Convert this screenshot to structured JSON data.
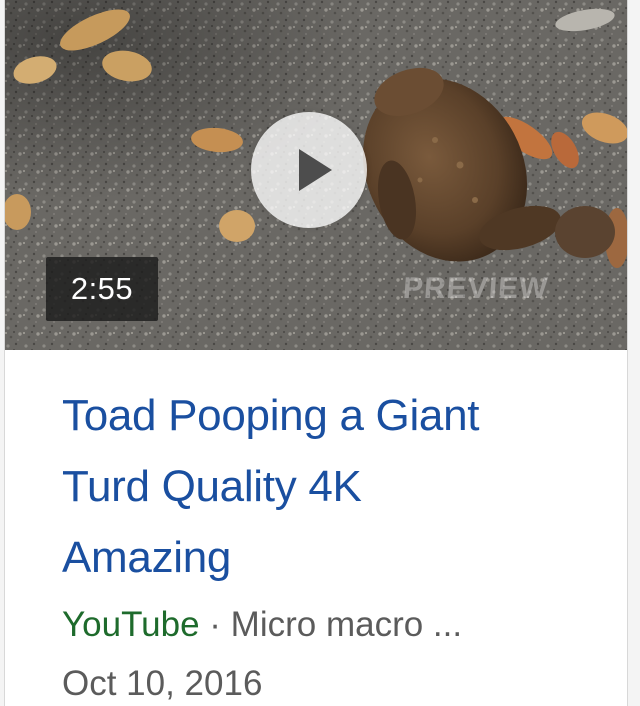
{
  "video": {
    "duration": "2:55",
    "watermark": "PREVIEW",
    "title_lines": [
      "Toad Pooping a Giant",
      "Turd Quality 4K",
      "Amazing"
    ],
    "source": "YouTube",
    "separator": "·",
    "channel": "Micro macro ...",
    "date": "Oct 10, 2016"
  },
  "icons": {
    "play": "play-icon"
  },
  "colors": {
    "title_link": "#1a4fa0",
    "source_green": "#1e6b2c",
    "meta_gray": "#5b5b5b",
    "duration_bg": "#1c1c1c"
  }
}
